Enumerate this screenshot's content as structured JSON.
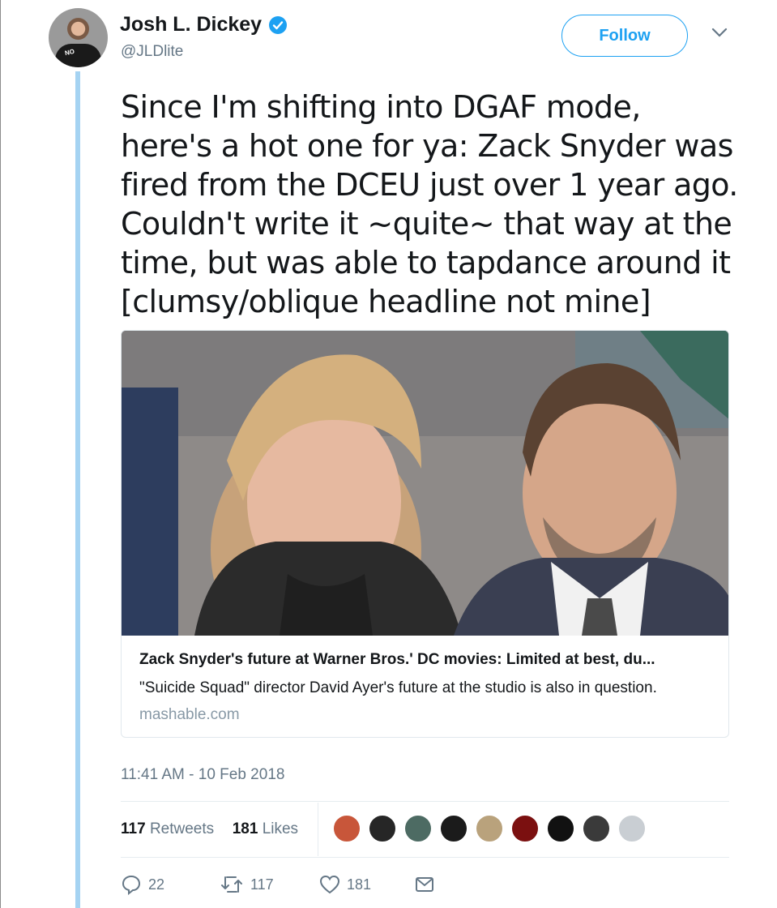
{
  "author": {
    "name": "Josh L. Dickey",
    "handle": "@JLDlite",
    "verified": true,
    "avatar_shirt_text": "NO"
  },
  "follow_label": "Follow",
  "tweet": {
    "text": "Since I'm shifting into DGAF mode,\nhere's a hot one for ya: Zack Snyder was\nfired from the DCEU just over 1 year ago.\nCouldn't write it ~quite~ that way at the\ntime, but was able to tapdance around it\n[clumsy/oblique headline not mine]"
  },
  "card": {
    "title": "Zack Snyder's future at Warner Bros.' DC movies: Limited at best, du...",
    "description": "\"Suicide Squad\" director David Ayer's future at the studio is also in question.",
    "domain": "mashable.com"
  },
  "timestamp": "11:41 AM - 10 Feb 2018",
  "stats": {
    "retweets": "117",
    "retweets_label": "Retweets",
    "likes": "181",
    "likes_label": "Likes"
  },
  "likers": [
    "liker-1",
    "liker-2",
    "liker-3",
    "liker-4",
    "liker-5",
    "liker-6",
    "liker-7",
    "liker-8",
    "liker-9"
  ],
  "actions": {
    "replies": "22",
    "retweets": "117",
    "likes": "181"
  },
  "colors": {
    "accent": "#1da1f2",
    "secondary_text": "#657786",
    "thread_line": "#a5d3f2"
  }
}
